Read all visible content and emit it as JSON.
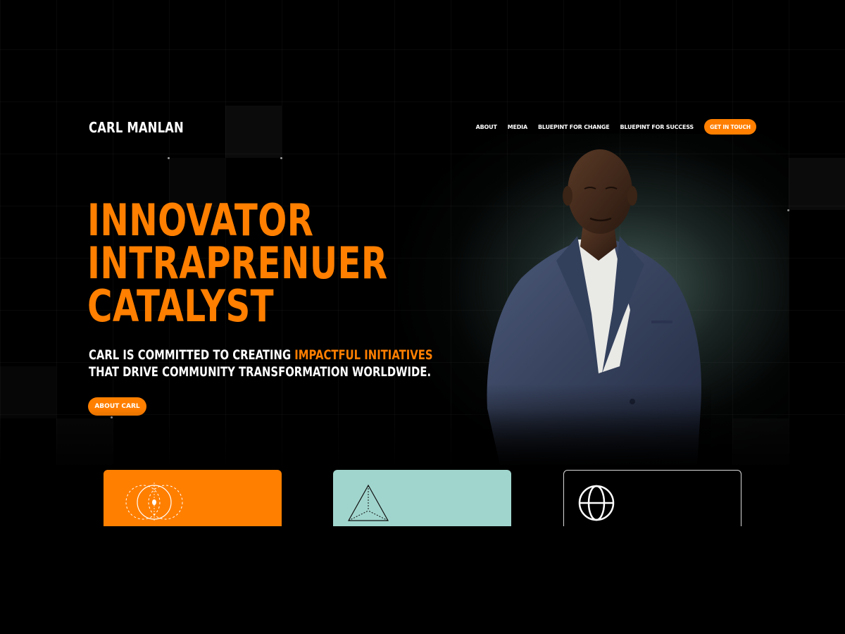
{
  "brand": {
    "logo_text": "CARL MANLAN",
    "accent_color": "#ff7f00"
  },
  "nav": {
    "items": [
      {
        "label": "ABOUT"
      },
      {
        "label": "MEDIA"
      },
      {
        "label": "BLUEPINT FOR CHANGE"
      },
      {
        "label": "BLUEPINT FOR SUCCESS"
      }
    ],
    "cta_label": "GET IN TOUCH"
  },
  "hero": {
    "headline": [
      "INNOVATOR",
      "INTRAPRENUER",
      "CATALYST"
    ],
    "tagline_part1": "CARL IS COMMITTED TO CREATING ",
    "tagline_accent": "IMPACTFUL INITIATIVES",
    "tagline_part2": "THAT DRIVE COMMUNITY TRANSFORMATION WORLDWIDE.",
    "button_label": "ABOUT CARL"
  },
  "cards": [
    {
      "color": "#ff7f00",
      "icon": "overlapping-circles-icon"
    },
    {
      "color": "#a0d5cd",
      "icon": "pyramid-icon"
    },
    {
      "color": "#000000",
      "icon": "globe-icon"
    }
  ]
}
